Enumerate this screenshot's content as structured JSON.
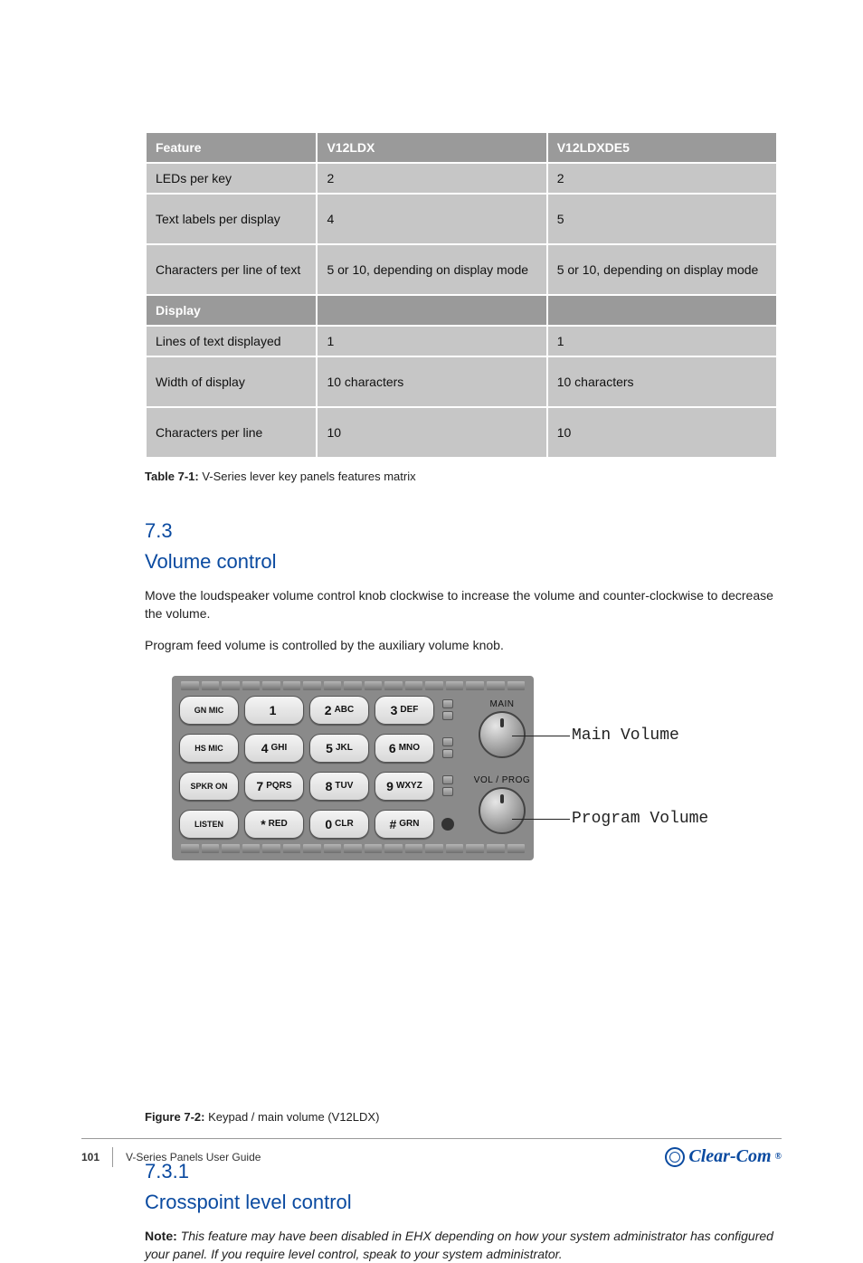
{
  "table": {
    "headers": [
      "Feature",
      "V12LDX",
      "V12LDXDE5"
    ],
    "rows": [
      {
        "cells": [
          "LEDs per key",
          "2",
          "2"
        ],
        "dark": false,
        "tall": false
      },
      {
        "cells": [
          "Text labels per display",
          "4",
          "5"
        ],
        "dark": false,
        "tall": true
      },
      {
        "cells": [
          "Characters per line of text",
          "5 or 10, depending on display mode",
          "5 or 10, depending on display mode"
        ],
        "dark": false,
        "tall": true
      },
      {
        "cells": [
          "Display",
          "",
          ""
        ],
        "dark": true,
        "tall": false
      },
      {
        "cells": [
          "Lines of text displayed",
          "1",
          "1"
        ],
        "dark": false,
        "tall": false
      },
      {
        "cells": [
          "Width of display",
          "10 characters",
          "10 characters"
        ],
        "dark": false,
        "tall": true
      },
      {
        "cells": [
          "Characters per line",
          "10",
          "10"
        ],
        "dark": false,
        "tall": true
      }
    ],
    "caption_label": "Table 7-1:",
    "caption_text": "V-Series lever key panels features matrix"
  },
  "sections": {
    "s1": {
      "num": "7.3",
      "title": "Volume control",
      "p": [
        "Move the loudspeaker volume control knob clockwise to increase the volume and counter-clockwise to decrease the volume.",
        "Program feed volume is controlled by the auxiliary volume knob."
      ]
    },
    "s2": {
      "num": "7.3.1",
      "title": "Crosspoint level control",
      "note_prefix": "Note:",
      "note": "This feature may have been disabled in EHX depending on how your system administrator has configured your panel. If you require level control, speak to your system administrator."
    }
  },
  "figure": {
    "callout1": "Main Volume",
    "callout2": "Program Volume",
    "keypad": {
      "side": [
        "GN MIC",
        "HS MIC",
        "SPKR ON",
        "LISTEN"
      ],
      "keys": [
        [
          "1",
          ""
        ],
        [
          "2",
          "ABC"
        ],
        [
          "3",
          "DEF"
        ],
        [
          "4",
          "GHI"
        ],
        [
          "5",
          "JKL"
        ],
        [
          "6",
          "MNO"
        ],
        [
          "7",
          "PQRS"
        ],
        [
          "8",
          "TUV"
        ],
        [
          "9",
          "WXYZ"
        ],
        [
          "*",
          "RED"
        ],
        [
          "0",
          "CLR"
        ],
        [
          "#",
          "GRN"
        ]
      ],
      "knob1": "MAIN",
      "knob2": "VOL / PROG"
    },
    "caption_label": "Figure 7-2:",
    "caption_text": "Keypad / main volume (V12LDX)"
  },
  "footer": {
    "page": "101",
    "title": "V-Series Panels User Guide",
    "brand": "Clear-Com"
  }
}
